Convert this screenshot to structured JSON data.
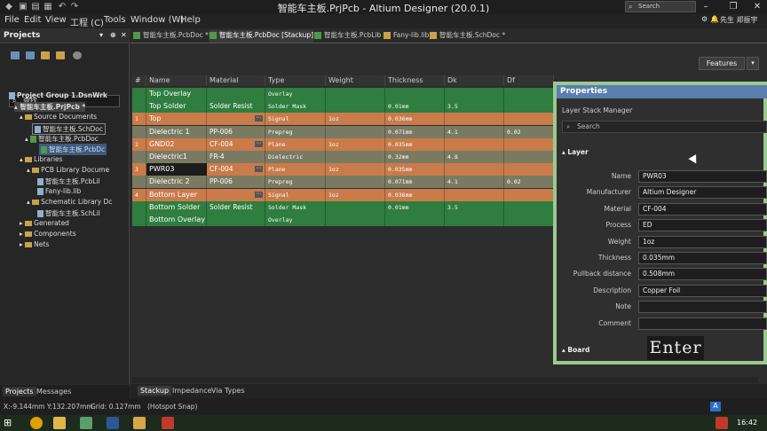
{
  "titlebar": {
    "title": "智能车主板.PrjPcb - Altium Designer (20.0.1)",
    "search": "Search",
    "user": "先生 郑振宇"
  },
  "menu": [
    "File",
    "Edit",
    "View",
    "工程 (C)",
    "Tools",
    "Window (W)",
    "Help"
  ],
  "projects": {
    "title": "Projects",
    "search": "查找",
    "tree": [
      {
        "label": "Project Group 1.DsnWrk",
        "bold": true
      },
      {
        "label": "智能车主板.PrjPcb *",
        "bold": true
      },
      {
        "label": "Source Documents"
      },
      {
        "label": "智能车主板.SchDoc"
      },
      {
        "label": "智能车主板.PcbDoc"
      },
      {
        "label": "智能车主板.PcbDc"
      },
      {
        "label": "Libraries"
      },
      {
        "label": "PCB Library Docume"
      },
      {
        "label": "智能车主板.PcbLil"
      },
      {
        "label": "Fany-lib.lib"
      },
      {
        "label": "Schematic Library Dc"
      },
      {
        "label": "智能车主板.SchLil"
      },
      {
        "label": "Generated"
      },
      {
        "label": "Components"
      },
      {
        "label": "Nets"
      }
    ],
    "tabs": [
      "Projects",
      "Messages"
    ]
  },
  "doc_tabs": [
    "智能车主板.PcbDoc *",
    "智能车主板.PcbDoc [Stackup] *",
    "智能车主板.PcbLib",
    "Fany-lib.lib",
    "智能车主板.SchDoc *"
  ],
  "features_label": "Features",
  "table": {
    "headers": [
      "#",
      "Name",
      "Material",
      "Type",
      "Weight",
      "Thickness",
      "Dk",
      "Df"
    ],
    "rows": [
      {
        "num": "",
        "name": "Top Overlay",
        "material": "",
        "type": "Overlay",
        "weight": "",
        "thickness": "",
        "dk": "",
        "df": "",
        "color": "#2f7d3f"
      },
      {
        "num": "",
        "name": "Top Solder",
        "material": "Solder Resist",
        "type": "Solder Mask",
        "weight": "",
        "thickness": "0.01mm",
        "dk": "3.5",
        "df": "",
        "color": "#2f7d3f"
      },
      {
        "num": "1",
        "name": "Top",
        "material": "",
        "type": "Signal",
        "weight": "1oz",
        "thickness": "0.036mm",
        "dk": "",
        "df": "",
        "color": "#c97b4a"
      },
      {
        "num": "",
        "name": "Dielectric 1",
        "material": "PP-006",
        "type": "Prepreg",
        "weight": "",
        "thickness": "0.071mm",
        "dk": "4.1",
        "df": "0.02",
        "color": "#7a7a62"
      },
      {
        "num": "2",
        "name": "GND02",
        "material": "CF-004",
        "type": "Plane",
        "weight": "1oz",
        "thickness": "0.035mm",
        "dk": "",
        "df": "",
        "color": "#c97b4a"
      },
      {
        "num": "",
        "name": "Dielectric1",
        "material": "FR-4",
        "type": "Dielectric",
        "weight": "",
        "thickness": "0.32mm",
        "dk": "4.8",
        "df": "",
        "color": "#7a7a62"
      },
      {
        "num": "3",
        "name": "PWR03",
        "material": "CF-004",
        "type": "Plane",
        "weight": "1oz",
        "thickness": "0.035mm",
        "dk": "",
        "df": "",
        "color": "#c97b4a"
      },
      {
        "num": "",
        "name": "Dielectric 2",
        "material": "PP-006",
        "type": "Prepreg",
        "weight": "",
        "thickness": "0.071mm",
        "dk": "4.1",
        "df": "0.02",
        "color": "#7a7a62"
      },
      {
        "num": "4",
        "name": "Bottom Layer",
        "material": "",
        "type": "Signal",
        "weight": "1oz",
        "thickness": "0.036mm",
        "dk": "",
        "df": "",
        "color": "#c97b4a"
      },
      {
        "num": "",
        "name": "Bottom Solder",
        "material": "Solder Resist",
        "type": "Solder Mask",
        "weight": "",
        "thickness": "0.01mm",
        "dk": "3.5",
        "df": "",
        "color": "#2f7d3f"
      },
      {
        "num": "",
        "name": "Bottom Overlay",
        "material": "",
        "type": "Overlay",
        "weight": "",
        "thickness": "",
        "dk": "",
        "df": "",
        "color": "#2f7d3f"
      }
    ]
  },
  "bottom_tabs": [
    "Stackup",
    "Impedance",
    "Via Types"
  ],
  "status": {
    "coords": "X:-9.144mm Y:132.207mm",
    "grid": "Grid: 0.127mm",
    "snap": "(Hotspot Snap)"
  },
  "clock": "16:42",
  "properties": {
    "title": "Properties",
    "subtitle": "Layer Stack Manager",
    "search": "Search",
    "section": "Layer",
    "board": "Board",
    "fields": [
      {
        "label": "Name",
        "value": "PWR03"
      },
      {
        "label": "Manufacturer",
        "value": "Altium Designer"
      },
      {
        "label": "Material",
        "value": "CF-004"
      },
      {
        "label": "Process",
        "value": "ED"
      },
      {
        "label": "Weight",
        "value": "1oz"
      },
      {
        "label": "Thickness",
        "value": "0.035mm"
      },
      {
        "label": "Pullback distance",
        "value": "0.508mm"
      },
      {
        "label": "Description",
        "value": "Copper Foil"
      },
      {
        "label": "Note",
        "value": ""
      },
      {
        "label": "Comment",
        "value": ""
      }
    ],
    "overlay_key": "Enter"
  }
}
